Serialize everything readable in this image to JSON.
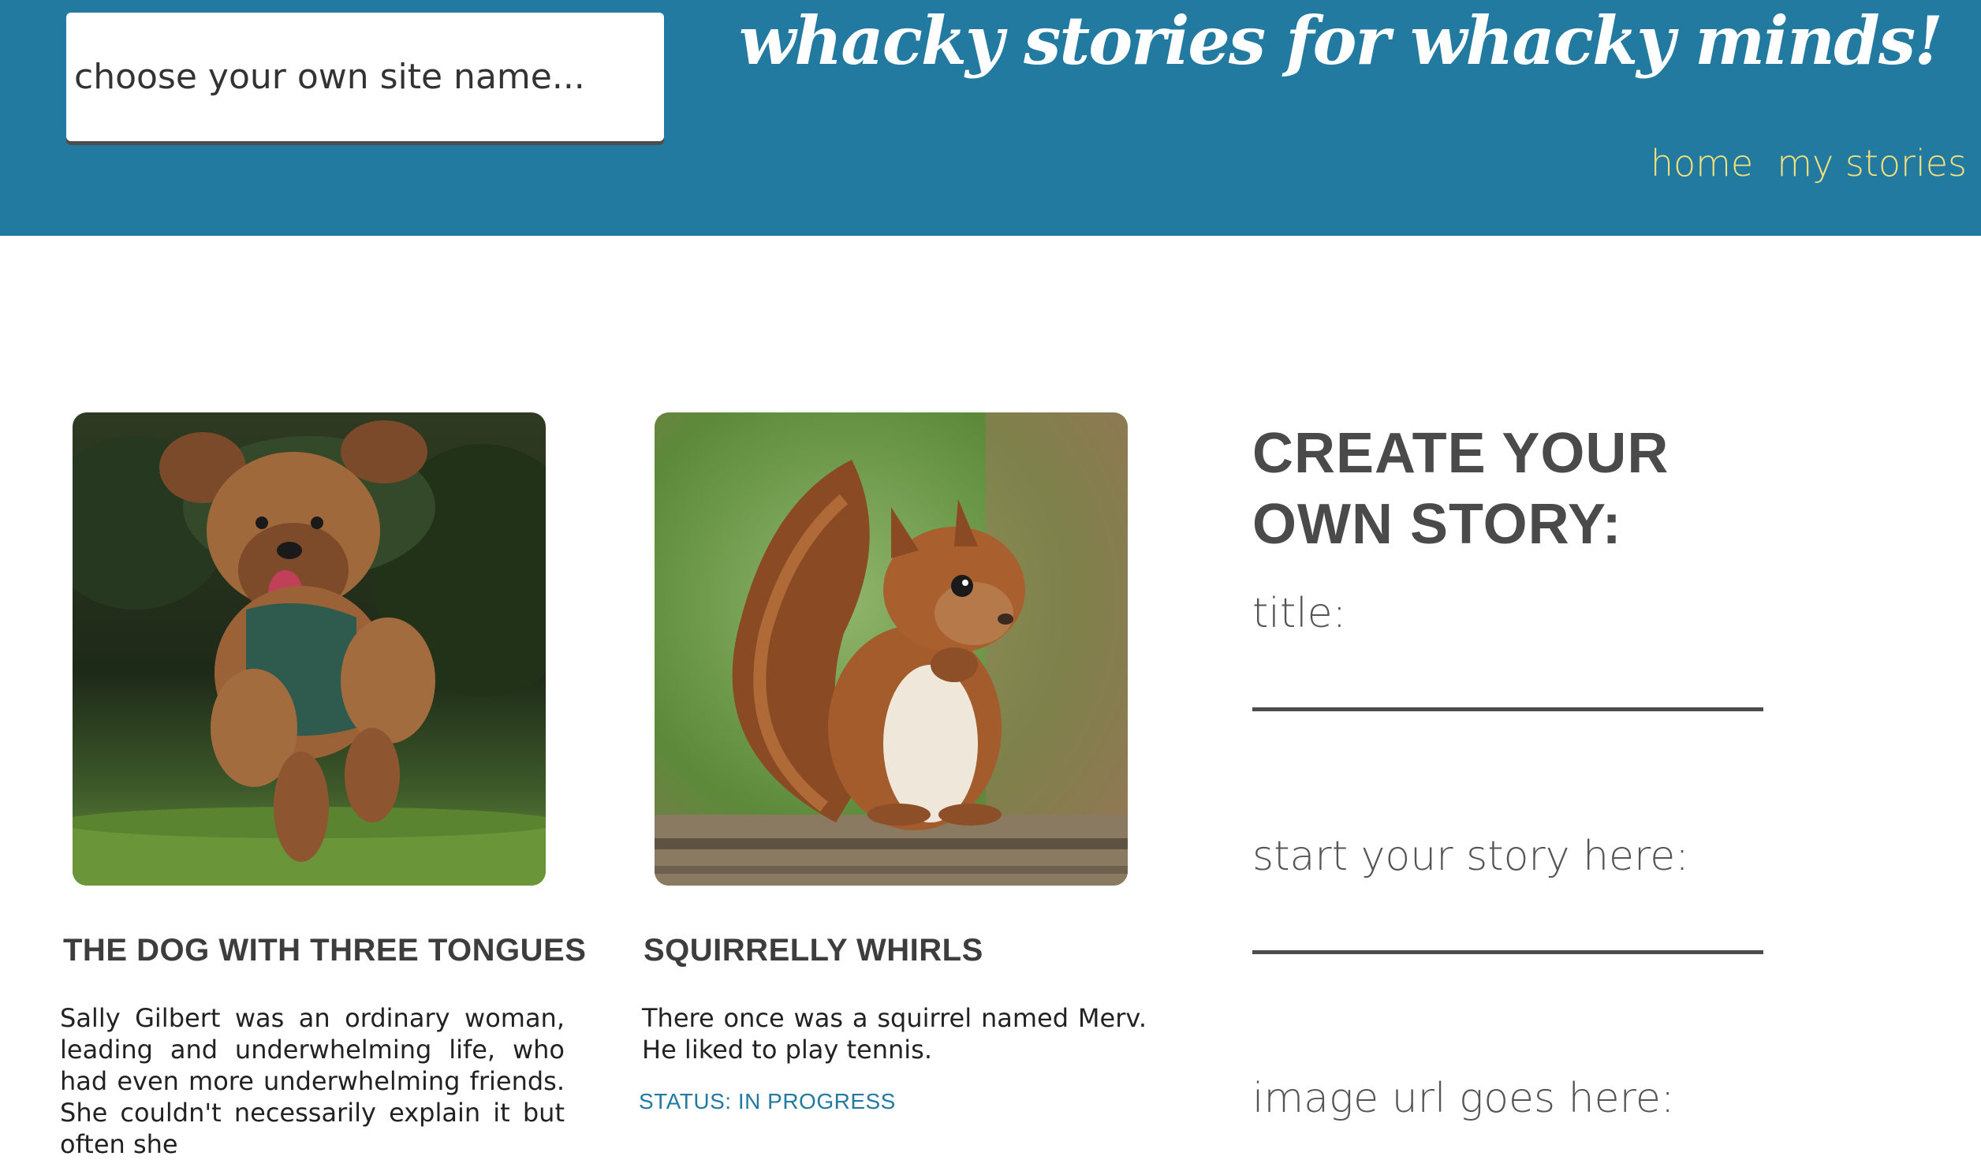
{
  "header": {
    "site_name_placeholder": "choose your own site name...",
    "title": "whacky stories for whacky minds!",
    "nav": [
      {
        "label": "home"
      },
      {
        "label": "my stories"
      }
    ],
    "colors": {
      "header_bg": "#227aa1",
      "nav_link": "#f5e07a"
    }
  },
  "stories": [
    {
      "image": "dog-photo",
      "title": "THE DOG WITH THREE TONGUES",
      "excerpt": "Sally Gilbert was an ordinary woman, leading and underwhelming life, who had even more underwhelming friends. She couldn't necessarily explain it but often she"
    },
    {
      "image": "squirrel-photo",
      "title": "SQUIRRELLY WHIRLS",
      "excerpt": "There once was a squirrel named Merv. He liked to play tennis.",
      "status": "STATUS: IN PROGRESS"
    }
  ],
  "create_form": {
    "heading": "CREATE YOUR OWN STORY:",
    "title_label": "title:",
    "story_label": "start your story here:",
    "image_label": "image url goes here:"
  }
}
